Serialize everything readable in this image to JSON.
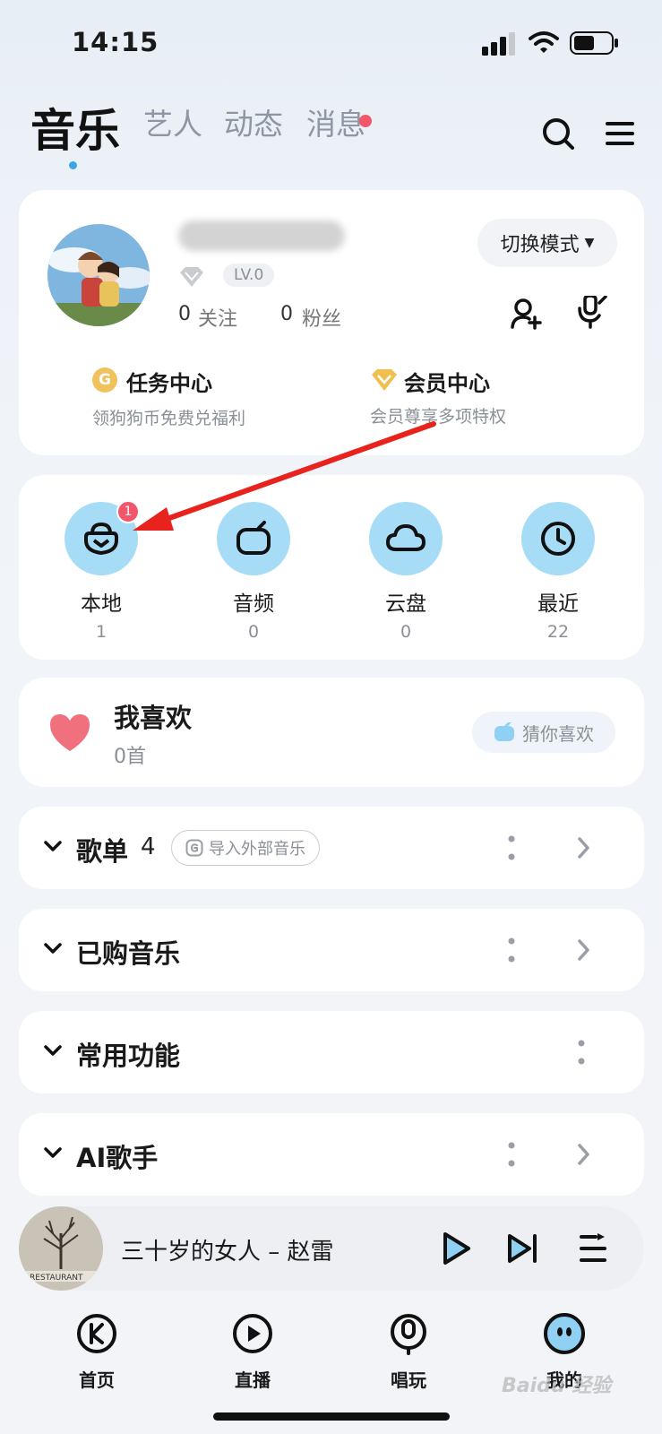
{
  "status_bar": {
    "time": "14:15"
  },
  "top_tabs": {
    "music": "音乐",
    "artist": "艺人",
    "feed": "动态",
    "messages": "消息"
  },
  "profile": {
    "level": "LV.0",
    "following_count": "0",
    "following_label": "关注",
    "followers_count": "0",
    "followers_label": "粉丝",
    "switch_mode_label": "切换模式",
    "task_center": {
      "coin": "G",
      "title": "任务中心",
      "subtitle": "领狗狗币免费兑福利"
    },
    "vip_center": {
      "title": "会员中心",
      "subtitle": "会员尊享多项特权"
    }
  },
  "quick_access": {
    "items": [
      {
        "label": "本地",
        "count": "1",
        "badge": "1"
      },
      {
        "label": "音频",
        "count": "0"
      },
      {
        "label": "云盘",
        "count": "0"
      },
      {
        "label": "最近",
        "count": "22"
      }
    ]
  },
  "favorites": {
    "title": "我喜欢",
    "count": "0首",
    "guess_label": "猜你喜欢"
  },
  "sections": {
    "playlists": {
      "title": "歌单",
      "count": "4",
      "import_label": "导入外部音乐"
    },
    "purchased": {
      "title": "已购音乐"
    },
    "functions": {
      "title": "常用功能"
    },
    "ai_singer": {
      "title": "AI歌手"
    }
  },
  "player": {
    "song": "三十岁的女人 – 赵雷",
    "art_text": "RESTAURANT"
  },
  "bottom_nav": {
    "home": "首页",
    "live": "直播",
    "sing": "唱玩",
    "me": "我的"
  },
  "watermark": "Baidu 经验",
  "colors": {
    "accent_blue": "#3aa6e8",
    "icon_circle": "#a7dcf6",
    "badge_red": "#f2566b",
    "heart_pink": "#f0707e",
    "annotation_red": "#e8231d"
  },
  "icons": [
    "signal-icon",
    "wifi-icon",
    "battery-icon",
    "search-icon",
    "menu-icon",
    "diamond-icon",
    "add-friend-icon",
    "mic-edit-icon",
    "coin-icon",
    "vip-diamond-icon",
    "local-music-icon",
    "audio-icon",
    "cloud-icon",
    "recent-clock-icon",
    "heart-icon",
    "guess-icon",
    "chevron-down-icon",
    "more-dots-icon",
    "chevron-right-icon",
    "import-icon",
    "play-icon",
    "next-icon",
    "playlist-icon",
    "home-k-icon",
    "live-icon",
    "sing-mic-icon",
    "me-avatar-icon"
  ]
}
